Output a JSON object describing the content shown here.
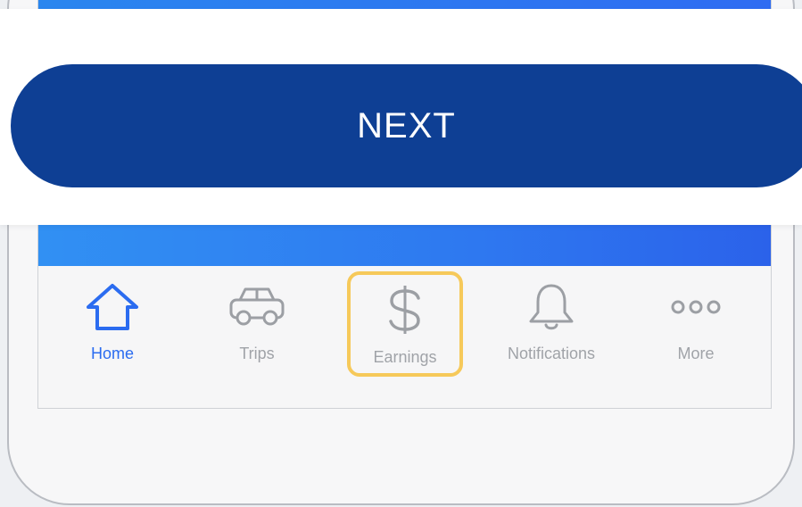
{
  "actions": {
    "next_label": "NEXT"
  },
  "tabbar": {
    "items": [
      {
        "label": "Home",
        "icon": "home-icon",
        "active": true
      },
      {
        "label": "Trips",
        "icon": "car-icon",
        "active": false
      },
      {
        "label": "Earnings",
        "icon": "dollar-icon",
        "active": false,
        "highlighted": true
      },
      {
        "label": "Notifications",
        "icon": "bell-icon",
        "active": false
      },
      {
        "label": "More",
        "icon": "more-dots-icon",
        "active": false
      }
    ]
  },
  "colors": {
    "primary_button": "#0e3f94",
    "brand_blue": "#2e78f0",
    "active_tab": "#2b6cf0",
    "inactive_tab": "#a0a3a8",
    "highlight": "#f6c95a"
  }
}
